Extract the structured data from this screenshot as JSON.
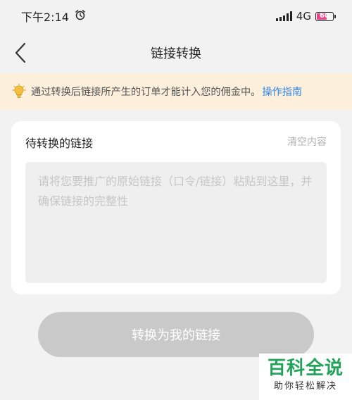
{
  "status_bar": {
    "time": "下午2:14",
    "network": "4G",
    "battery_level": "60"
  },
  "nav": {
    "title": "链接转换"
  },
  "notice": {
    "text": "通过转换后链接所产生的订单才能计入您的佣金中。",
    "link_label": "操作指南"
  },
  "link_card": {
    "title": "待转换的链接",
    "clear_label": "清空内容",
    "input_value": "",
    "input_placeholder": "请将您要推广的原始链接（口令/链接）粘贴到这里，并确保链接的完整性"
  },
  "convert_button": {
    "label": "转换为我的链接"
  },
  "watermark": {
    "main": "百科全说",
    "sub": "助你轻松解决"
  },
  "colors": {
    "notice_bg": "#fcefdb",
    "link_blue": "#2f86e8",
    "button_disabled": "#c9c9c9",
    "watermark_green": "#22a35a"
  }
}
